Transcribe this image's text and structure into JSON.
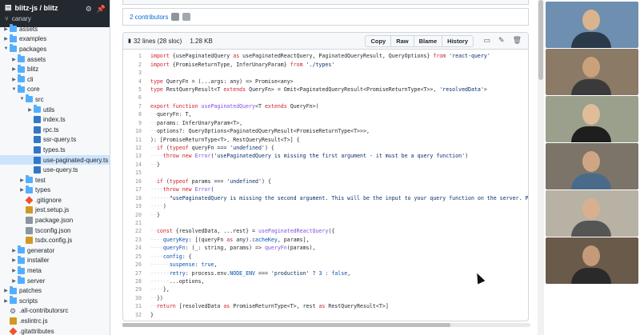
{
  "sidebar": {
    "repo": "blitz-js / blitz",
    "branch": "canary",
    "items": [
      {
        "label": "assets",
        "type": "folder",
        "depth": 0,
        "expanded": false
      },
      {
        "label": "examples",
        "type": "folder",
        "depth": 0,
        "expanded": false
      },
      {
        "label": "packages",
        "type": "folder",
        "depth": 0,
        "expanded": true
      },
      {
        "label": "assets",
        "type": "folder",
        "depth": 1,
        "expanded": false
      },
      {
        "label": "blitz",
        "type": "folder",
        "depth": 1,
        "expanded": false
      },
      {
        "label": "cli",
        "type": "folder",
        "depth": 1,
        "expanded": false
      },
      {
        "label": "core",
        "type": "folder",
        "depth": 1,
        "expanded": true
      },
      {
        "label": "src",
        "type": "folder",
        "depth": 2,
        "expanded": true
      },
      {
        "label": "utils",
        "type": "folder",
        "depth": 3,
        "expanded": false
      },
      {
        "label": "index.ts",
        "type": "ts",
        "depth": 3
      },
      {
        "label": "rpc.ts",
        "type": "ts",
        "depth": 3
      },
      {
        "label": "ssr-query.ts",
        "type": "ts",
        "depth": 3
      },
      {
        "label": "types.ts",
        "type": "ts",
        "depth": 3
      },
      {
        "label": "use-paginated-query.ts",
        "type": "ts",
        "depth": 3,
        "active": true
      },
      {
        "label": "use-query.ts",
        "type": "ts",
        "depth": 3
      },
      {
        "label": "test",
        "type": "folder",
        "depth": 2,
        "expanded": false
      },
      {
        "label": "types",
        "type": "folder",
        "depth": 2,
        "expanded": false
      },
      {
        "label": ".gitignore",
        "type": "git",
        "depth": 2
      },
      {
        "label": "jest.setup.js",
        "type": "js",
        "depth": 2
      },
      {
        "label": "package.json",
        "type": "json",
        "depth": 2
      },
      {
        "label": "tsconfig.json",
        "type": "json",
        "depth": 2
      },
      {
        "label": "tsdx.config.js",
        "type": "js",
        "depth": 2
      },
      {
        "label": "generator",
        "type": "folder",
        "depth": 1,
        "expanded": false
      },
      {
        "label": "installer",
        "type": "folder",
        "depth": 1,
        "expanded": false
      },
      {
        "label": "meta",
        "type": "folder",
        "depth": 1,
        "expanded": false
      },
      {
        "label": "server",
        "type": "folder",
        "depth": 1,
        "expanded": false
      },
      {
        "label": "patches",
        "type": "folder",
        "depth": 0,
        "expanded": false
      },
      {
        "label": "scripts",
        "type": "folder",
        "depth": 0,
        "expanded": false
      },
      {
        "label": ".all-contributorsrc",
        "type": "gear",
        "depth": 0
      },
      {
        "label": ".eslintrc.js",
        "type": "js",
        "depth": 0
      },
      {
        "label": ".gitattributes",
        "type": "git",
        "depth": 0
      }
    ]
  },
  "file": {
    "contributors": "2 contributors",
    "lines": "32 lines (28 sloc)",
    "size": "1.28 KB",
    "buttons": [
      "Copy",
      "Raw",
      "Blame",
      "History"
    ],
    "code": [
      [
        [
          "k",
          "import "
        ],
        [
          "",
          "{usePaginatedQuery "
        ],
        [
          "k",
          "as "
        ],
        [
          "",
          "usePaginatedReactQuery, PaginatedQueryResult, QueryOptions} "
        ],
        [
          "k",
          "from "
        ],
        [
          "s",
          "'react-query'"
        ]
      ],
      [
        [
          "k",
          "import "
        ],
        [
          "",
          "{PromiseReturnType, InferUnaryParam} "
        ],
        [
          "k",
          "from "
        ],
        [
          "s",
          "'./types'"
        ]
      ],
      [],
      [
        [
          "k",
          "type "
        ],
        [
          "",
          "QueryFn = (...args: any) => Promise<any>"
        ]
      ],
      [
        [
          "k",
          "type "
        ],
        [
          "",
          "RestQueryResult<T "
        ],
        [
          "k",
          "extends "
        ],
        [
          "",
          "QueryFn> = Omit<PaginatedQueryResult<PromiseReturnType<T>>, "
        ],
        [
          "s",
          "'resolvedData'"
        ],
        [
          "",
          ">"
        ]
      ],
      [],
      [
        [
          "k",
          "export function "
        ],
        [
          "f",
          "usePaginatedQuery"
        ],
        [
          "",
          "<T "
        ],
        [
          "k",
          "extends "
        ],
        [
          "",
          "QueryFn>("
        ]
      ],
      [
        [
          "d",
          "··"
        ],
        [
          "",
          "queryFn: T,"
        ]
      ],
      [
        [
          "d",
          "··"
        ],
        [
          "",
          "params: InferUnaryParam<T>,"
        ]
      ],
      [
        [
          "d",
          "··"
        ],
        [
          "",
          "options?: QueryOptions<PaginatedQueryResult<PromiseReturnType<T>>>,"
        ]
      ],
      [
        [
          "",
          "): [PromiseReturnType<T>, RestQueryResult<T>] {"
        ]
      ],
      [
        [
          "d",
          "··"
        ],
        [
          "k",
          "if "
        ],
        [
          "",
          "("
        ],
        [
          "k",
          "typeof "
        ],
        [
          "",
          "queryFn === "
        ],
        [
          "s",
          "'undefined'"
        ],
        [
          "",
          ") {"
        ]
      ],
      [
        [
          "d",
          "····"
        ],
        [
          "k",
          "throw new "
        ],
        [
          "f",
          "Error"
        ],
        [
          "",
          "("
        ],
        [
          "s",
          "'usePaginatedQuery is missing the first argument - it must be a query function'"
        ],
        [
          "",
          ")"
        ]
      ],
      [
        [
          "d",
          "··"
        ],
        [
          "",
          "}"
        ]
      ],
      [],
      [
        [
          "d",
          "··"
        ],
        [
          "k",
          "if "
        ],
        [
          "",
          "("
        ],
        [
          "k",
          "typeof "
        ],
        [
          "",
          "params === "
        ],
        [
          "s",
          "'undefined'"
        ],
        [
          "",
          ") {"
        ]
      ],
      [
        [
          "d",
          "····"
        ],
        [
          "k",
          "throw new "
        ],
        [
          "f",
          "Error"
        ],
        [
          "",
          "("
        ]
      ],
      [
        [
          "d",
          "······"
        ],
        [
          "s",
          "\"usePaginatedQuery is missing the second argument. This will be the input to your query function on the server. Pass `nul"
        ]
      ],
      [
        [
          "d",
          "····"
        ],
        [
          "",
          ")"
        ]
      ],
      [
        [
          "d",
          "··"
        ],
        [
          "",
          "}"
        ]
      ],
      [],
      [
        [
          "d",
          "··"
        ],
        [
          "k",
          "const "
        ],
        [
          "",
          "{resolvedData, ...rest} = "
        ],
        [
          "f",
          "usePaginatedReactQuery"
        ],
        [
          "",
          "({"
        ]
      ],
      [
        [
          "d",
          "····"
        ],
        [
          "c",
          "queryKey"
        ],
        [
          "",
          ": [(queryFn "
        ],
        [
          "k",
          "as "
        ],
        [
          "",
          "any)."
        ],
        [
          "c",
          "cacheKey"
        ],
        [
          "",
          ", params],"
        ]
      ],
      [
        [
          "d",
          "····"
        ],
        [
          "c",
          "queryFn"
        ],
        [
          "",
          ": (_: string, params) => "
        ],
        [
          "f",
          "queryFn"
        ],
        [
          "",
          "(params),"
        ]
      ],
      [
        [
          "d",
          "····"
        ],
        [
          "c",
          "config"
        ],
        [
          "",
          ": {"
        ]
      ],
      [
        [
          "d",
          "······"
        ],
        [
          "c",
          "suspense"
        ],
        [
          "",
          ": "
        ],
        [
          "c",
          "true"
        ],
        [
          "",
          ","
        ]
      ],
      [
        [
          "d",
          "······"
        ],
        [
          "c",
          "retry"
        ],
        [
          "",
          ": process.env."
        ],
        [
          "c",
          "NODE_ENV"
        ],
        [
          "",
          " === "
        ],
        [
          "s",
          "'production'"
        ],
        [
          "",
          " ? "
        ],
        [
          "c",
          "3"
        ],
        [
          "",
          " : "
        ],
        [
          "c",
          "false"
        ],
        [
          "",
          ","
        ]
      ],
      [
        [
          "d",
          "······"
        ],
        [
          "",
          "...options,"
        ]
      ],
      [
        [
          "d",
          "····"
        ],
        [
          "",
          "},"
        ]
      ],
      [
        [
          "d",
          "··"
        ],
        [
          "",
          "})"
        ]
      ],
      [
        [
          "d",
          "··"
        ],
        [
          "k",
          "return "
        ],
        [
          "",
          "[resolvedData "
        ],
        [
          "k",
          "as "
        ],
        [
          "",
          "PromiseReturnType<T>, rest "
        ],
        [
          "k",
          "as "
        ],
        [
          "",
          "RestQueryResult<T>]"
        ]
      ],
      [
        [
          "",
          "}"
        ]
      ]
    ]
  },
  "video": {
    "tiles": [
      {
        "bg": "#6f8fb0",
        "skin": "#d9b48f",
        "shirt": "#2b3a4a"
      },
      {
        "bg": "#8a7a66",
        "skin": "#c9a27c",
        "shirt": "#3a3a3a"
      },
      {
        "bg": "#9aa08c",
        "skin": "#e0bc98",
        "shirt": "#1e1e1e"
      },
      {
        "bg": "#7c7468",
        "skin": "#cfa684",
        "shirt": "#4a6a8a"
      },
      {
        "bg": "#b8b2a4",
        "skin": "#d8b090",
        "shirt": "#555"
      },
      {
        "bg": "#6a5a4a",
        "skin": "#c49a78",
        "shirt": "#2a2a2a"
      }
    ]
  },
  "colors": {
    "accent": "#0969da",
    "active_row": "#cde4fb"
  }
}
